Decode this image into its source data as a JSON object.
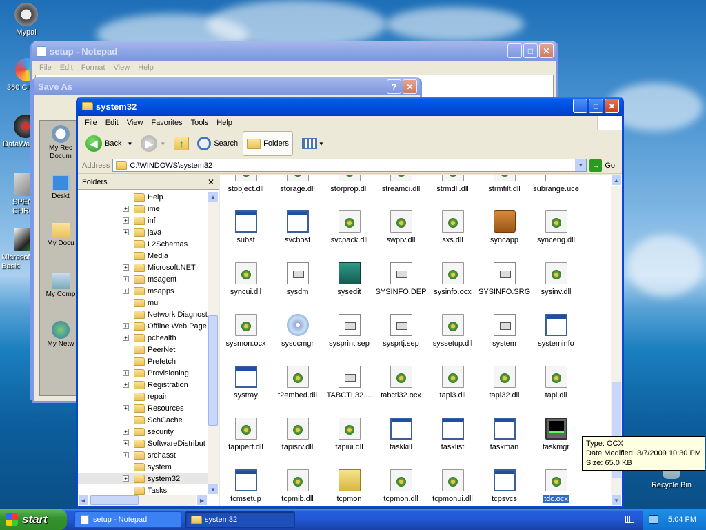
{
  "desktop": {
    "icons": [
      {
        "label": "Mypal"
      },
      {
        "label": "360 Ch"
      },
      {
        "label": "DataWa"
      },
      {
        "label": "SPEC CHRO"
      },
      {
        "label": "Microsoft Basic"
      },
      {
        "label": "Recycle Bin"
      }
    ]
  },
  "notepad": {
    "title": "setup - Notepad",
    "menu": [
      "File",
      "Edit",
      "Format",
      "View",
      "Help"
    ]
  },
  "saveas": {
    "title": "Save As",
    "places": [
      "My Rec Docum",
      "Deskt",
      "My Docu",
      "My Comp",
      "My Netw"
    ]
  },
  "explorer": {
    "title": "system32",
    "menu": [
      "File",
      "Edit",
      "View",
      "Favorites",
      "Tools",
      "Help"
    ],
    "toolbar": {
      "back": "Back",
      "search": "Search",
      "folders": "Folders"
    },
    "address": {
      "label": "Address",
      "value": "C:\\WINDOWS\\system32",
      "go": "Go"
    },
    "folders_pane": {
      "title": "Folders",
      "nodes": [
        {
          "label": "Help",
          "expand": false
        },
        {
          "label": "ime",
          "expand": true
        },
        {
          "label": "inf",
          "expand": true
        },
        {
          "label": "java",
          "expand": true
        },
        {
          "label": "L2Schemas",
          "expand": false
        },
        {
          "label": "Media",
          "expand": false
        },
        {
          "label": "Microsoft.NET",
          "expand": true
        },
        {
          "label": "msagent",
          "expand": true
        },
        {
          "label": "msapps",
          "expand": true
        },
        {
          "label": "mui",
          "expand": false
        },
        {
          "label": "Network Diagnost",
          "expand": false
        },
        {
          "label": "Offline Web Page",
          "expand": true
        },
        {
          "label": "pchealth",
          "expand": true
        },
        {
          "label": "PeerNet",
          "expand": false
        },
        {
          "label": "Prefetch",
          "expand": false
        },
        {
          "label": "Provisioning",
          "expand": true
        },
        {
          "label": "Registration",
          "expand": true
        },
        {
          "label": "repair",
          "expand": false
        },
        {
          "label": "Resources",
          "expand": true
        },
        {
          "label": "SchCache",
          "expand": false
        },
        {
          "label": "security",
          "expand": true
        },
        {
          "label": "SoftwareDistribut",
          "expand": true
        },
        {
          "label": "srchasst",
          "expand": true
        },
        {
          "label": "system",
          "expand": false
        },
        {
          "label": "system32",
          "expand": true
        },
        {
          "label": "Tasks",
          "expand": false
        }
      ]
    },
    "files": [
      [
        "stobject.dll",
        "storage.dll",
        "storprop.dll",
        "streamci.dll",
        "strmdll.dll",
        "strmfilt.dll",
        "subrange.uce"
      ],
      [
        "subst",
        "svchost",
        "svcpack.dll",
        "swprv.dll",
        "sxs.dll",
        "syncapp",
        "synceng.dll"
      ],
      [
        "syncui.dll",
        "sysdm",
        "sysedit",
        "SYSINFO.DEP",
        "sysinfo.ocx",
        "SYSINFO.SRG",
        "sysinv.dll"
      ],
      [
        "sysmon.ocx",
        "sysocmgr",
        "sysprint.sep",
        "sysprtj.sep",
        "syssetup.dll",
        "system",
        "systeminfo"
      ],
      [
        "systray",
        "t2embed.dll",
        "TABCTL32....",
        "tabctl32.ocx",
        "tapi3.dll",
        "tapi32.dll",
        "tapi.dll"
      ],
      [
        "tapiperf.dll",
        "tapisrv.dll",
        "tapiui.dll",
        "taskkill",
        "tasklist",
        "taskman",
        "taskmgr"
      ],
      [
        "tcmsetup",
        "tcpmib.dll",
        "tcpmon",
        "tcpmon.dll",
        "tcpmonui.dll",
        "tcpsvcs",
        "tdc.ocx"
      ]
    ],
    "icon_types": [
      [
        "dll",
        "dll",
        "dll",
        "dll",
        "dll",
        "dll",
        "doc"
      ],
      [
        "exe",
        "exe",
        "dll",
        "dll",
        "dll",
        "case",
        "dll"
      ],
      [
        "dll",
        "doc",
        "edit",
        "doc",
        "dll",
        "doc",
        "dll"
      ],
      [
        "dll",
        "cd",
        "doc",
        "doc",
        "dll",
        "doc",
        "exe"
      ],
      [
        "exe",
        "dll",
        "doc",
        "dll",
        "dll",
        "dll",
        "dll"
      ],
      [
        "dll",
        "dll",
        "dll",
        "exe",
        "exe",
        "exe",
        "monitor"
      ],
      [
        "exe",
        "dll",
        "pad",
        "dll",
        "dll",
        "exe",
        "dll"
      ]
    ]
  },
  "tooltip": {
    "line1": "Type: OCX",
    "line2": "Date Modified: 3/7/2009 10:30 PM",
    "line3": "Size: 65.0 KB"
  },
  "taskbar": {
    "start": "start",
    "tasks": [
      "setup - Notepad",
      "system32"
    ],
    "clock": "5:04 PM"
  }
}
